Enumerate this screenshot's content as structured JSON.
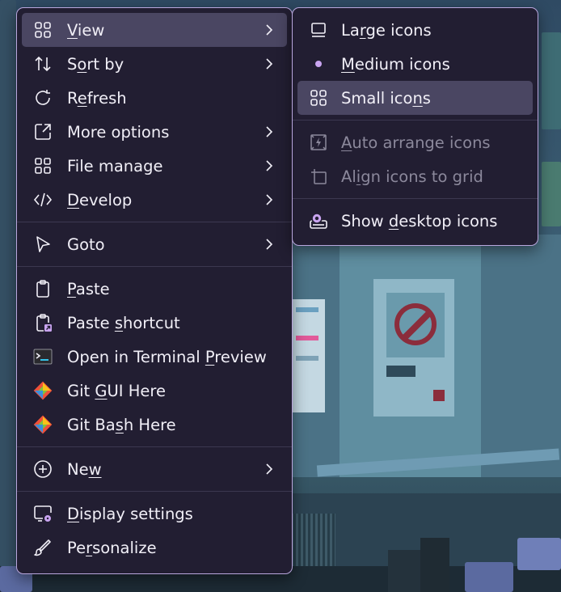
{
  "main_menu": {
    "items": [
      {
        "label": "View",
        "icon": "grid-icon",
        "submenu": true
      },
      {
        "label": "Sort by",
        "icon": "sort-icon",
        "submenu": true
      },
      {
        "label": "Refresh",
        "icon": "refresh-icon",
        "submenu": false
      },
      {
        "label": "More options",
        "icon": "external-icon",
        "submenu": true
      },
      {
        "label": "File manage",
        "icon": "apps-icon",
        "submenu": true
      },
      {
        "label": "Develop",
        "icon": "code-icon",
        "submenu": true
      },
      {
        "label": "Goto",
        "icon": "cursor-icon",
        "submenu": true
      },
      {
        "label": "Paste",
        "icon": "clipboard-icon",
        "submenu": false
      },
      {
        "label": "Paste shortcut",
        "icon": "clipboard-shortcut-icon",
        "submenu": false
      },
      {
        "label": "Open in Terminal Preview",
        "icon": "terminal-icon",
        "submenu": false
      },
      {
        "label": "Git GUI Here",
        "icon": "git-icon",
        "submenu": false
      },
      {
        "label": "Git Bash Here",
        "icon": "git-icon",
        "submenu": false
      },
      {
        "label": "New",
        "icon": "plus-circle-icon",
        "submenu": true
      },
      {
        "label": "Display settings",
        "icon": "display-settings-icon",
        "submenu": false
      },
      {
        "label": "Personalize",
        "icon": "brush-icon",
        "submenu": false
      }
    ]
  },
  "view_submenu": {
    "items": [
      {
        "label": "Large icons",
        "icon": "monitor-icon",
        "enabled": true
      },
      {
        "label": "Medium icons",
        "icon": "bullet-icon",
        "enabled": true,
        "selected": true
      },
      {
        "label": "Small icons",
        "icon": "grid-icon",
        "enabled": true,
        "highlighted": true
      },
      {
        "label": "Auto arrange icons",
        "icon": "auto-arrange-icon",
        "enabled": false
      },
      {
        "label": "Align icons to grid",
        "icon": "align-grid-icon",
        "enabled": false
      },
      {
        "label": "Show desktop icons",
        "icon": "show-desktop-icon",
        "enabled": true
      }
    ]
  },
  "colors": {
    "menu_bg": "#221e32",
    "menu_border": "#b9a7dd",
    "highlight": "#4a4662",
    "text": "#f1eff7",
    "disabled_text": "#8b889b",
    "accent": "#c9a4f0"
  }
}
